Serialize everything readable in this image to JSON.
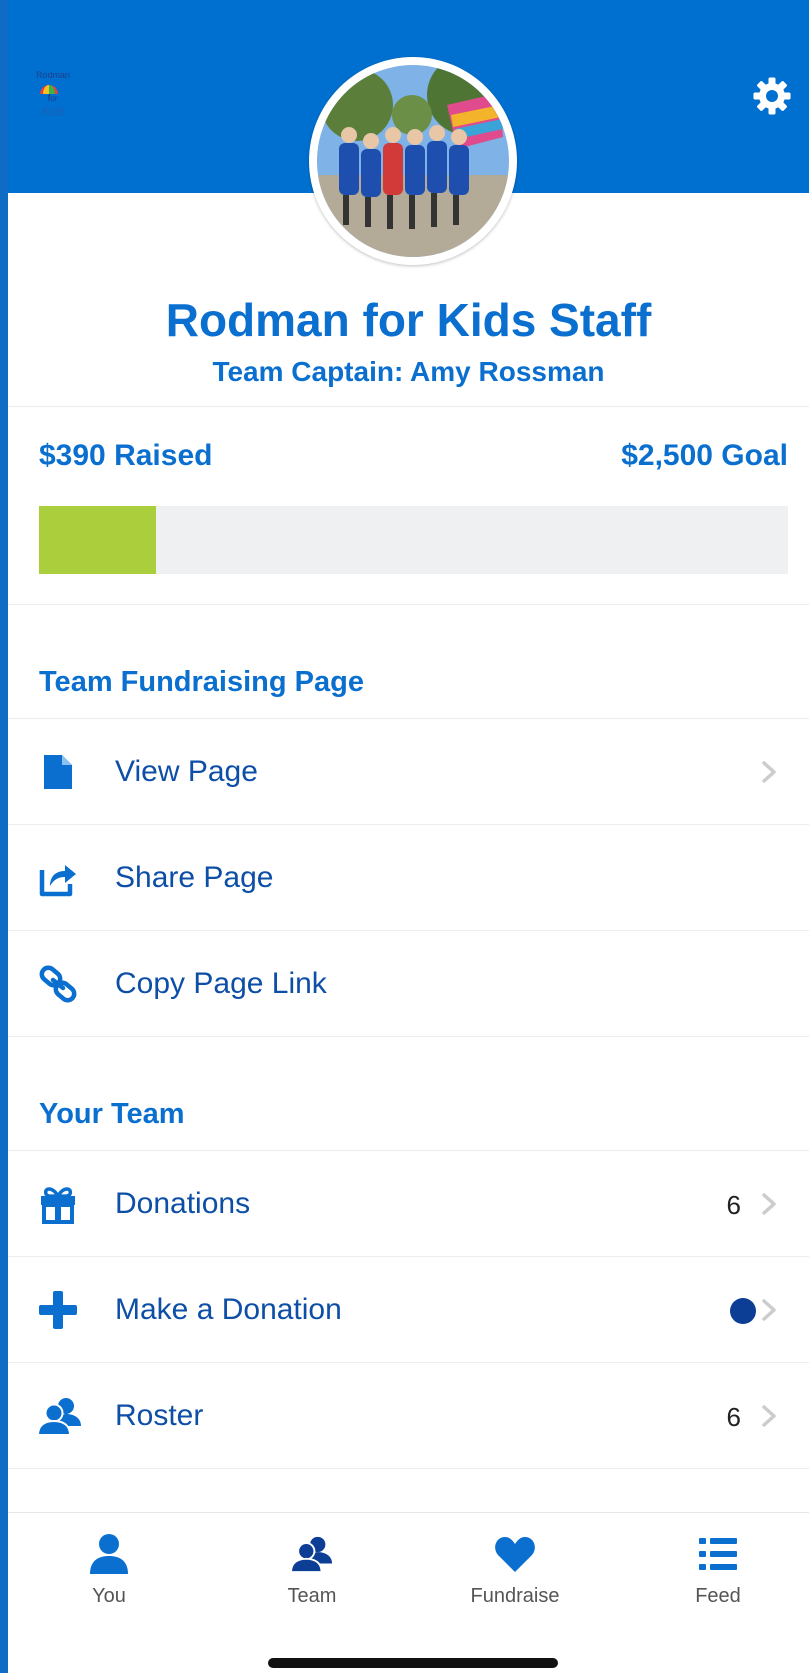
{
  "header": {
    "logo_text_top": "Rodman",
    "logo_text_middle": "for",
    "logo_text_bottom": "Kids",
    "settings_icon": "gear-icon",
    "avatar_icon": "team-photo"
  },
  "team": {
    "name": "Rodman for Kids Staff",
    "captain": "Team Captain: Amy Rossman"
  },
  "progress": {
    "raised_label": "$390 Raised",
    "goal_label": "$2,500 Goal",
    "raised_value": 390,
    "goal_value": 2500,
    "fill_color": "#abce3c",
    "track_color": "#eff0f1"
  },
  "fundraising_section": {
    "title": "Team Fundraising Page",
    "items": [
      {
        "label": "View Page",
        "icon": "document-icon",
        "has_chevron": true
      },
      {
        "label": "Share Page",
        "icon": "share-icon",
        "has_chevron": false
      },
      {
        "label": "Copy Page Link",
        "icon": "link-icon",
        "has_chevron": false
      }
    ]
  },
  "team_section": {
    "title": "Your Team",
    "items": [
      {
        "label": "Donations",
        "icon": "gift-icon",
        "count": "6",
        "has_chevron": true
      },
      {
        "label": "Make a Donation",
        "icon": "plus-icon",
        "indicator": "dot",
        "has_chevron": true
      },
      {
        "label": "Roster",
        "icon": "users-icon",
        "count": "6",
        "has_chevron": true
      }
    ]
  },
  "tabbar": {
    "tabs": [
      {
        "label": "You",
        "icon": "person-icon",
        "color": "#0a6fcf"
      },
      {
        "label": "Team",
        "icon": "users-icon",
        "color": "#0d3e95"
      },
      {
        "label": "Fundraise",
        "icon": "heart-icon",
        "color": "#0a6fcf"
      },
      {
        "label": "Feed",
        "icon": "list-icon",
        "color": "#0a6fcf"
      }
    ]
  },
  "colors": {
    "brand_blue": "#0070d0",
    "text_blue": "#0a6fcf",
    "row_text": "#0d4ea6",
    "dark_navy": "#0d3e95",
    "chevron": "#cccccc"
  }
}
